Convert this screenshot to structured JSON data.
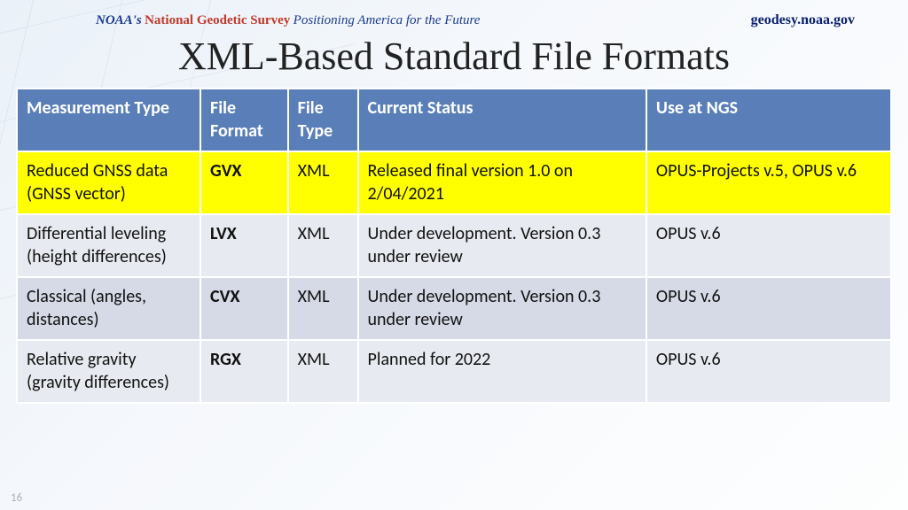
{
  "header": {
    "prefix": "NOAA's",
    "org": "National Geodetic Survey",
    "tagline": "Positioning America for the Future",
    "url": "geodesy.noaa.gov"
  },
  "title": "XML-Based Standard File Formats",
  "columns": [
    "Measurement Type",
    "File Format",
    "File Type",
    "Current Status",
    "Use at NGS"
  ],
  "rows": [
    {
      "measurement": "Reduced GNSS data (GNSS vector)",
      "format": "GVX",
      "type": "XML",
      "status": "Released final version 1.0 on 2/04/2021",
      "use": "OPUS-Projects v.5, OPUS v.6",
      "highlight": true
    },
    {
      "measurement": "Differential leveling (height differences)",
      "format": "LVX",
      "type": "XML",
      "status": "Under development. Version 0.3 under review",
      "use": "OPUS v.6"
    },
    {
      "measurement": "Classical (angles, distances)",
      "format": "CVX",
      "type": "XML",
      "status": "Under development. Version 0.3 under review",
      "use": "OPUS v.6"
    },
    {
      "measurement": "Relative gravity (gravity differences)",
      "format": "RGX",
      "type": "XML",
      "status": "Planned for 2022",
      "use": "OPUS v.6"
    }
  ],
  "page_number": "16"
}
